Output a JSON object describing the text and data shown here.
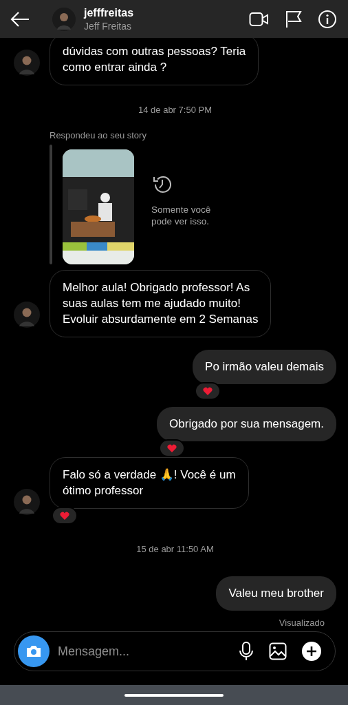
{
  "header": {
    "username": "jefffreitas",
    "full_name": "Jeff Freitas"
  },
  "messages": [
    {
      "kind": "incoming",
      "lines": [
        "dúvidas com outras pessoas? Teria",
        "como entrar ainda ?"
      ],
      "reacted": false
    },
    {
      "kind": "timestamp",
      "text": "14 de abr 7:50 PM"
    },
    {
      "kind": "story_reply",
      "label": "Respondeu ao seu story",
      "notice": "Somente você pode ver isso."
    },
    {
      "kind": "incoming",
      "lines": [
        "Melhor aula! Obrigado professor! As",
        "suas aulas tem me ajudado muito!",
        "Evoluir absurdamente em 2 Semanas"
      ],
      "reacted": false
    },
    {
      "kind": "outgoing",
      "lines": [
        "Po irmão valeu demais"
      ],
      "reacted": true
    },
    {
      "kind": "outgoing",
      "lines": [
        "Obrigado por sua mensagem."
      ],
      "reacted": true
    },
    {
      "kind": "incoming",
      "lines": [
        "Falo só a verdade 🙏! Você é um",
        "ótimo professor"
      ],
      "reacted": true
    },
    {
      "kind": "timestamp",
      "text": "15 de abr 11:50 AM"
    },
    {
      "kind": "outgoing",
      "lines": [
        "Valeu meu brother"
      ],
      "reacted": false
    },
    {
      "kind": "seen",
      "text": "Visualizado"
    }
  ],
  "composer": {
    "placeholder": "Mensagem..."
  }
}
